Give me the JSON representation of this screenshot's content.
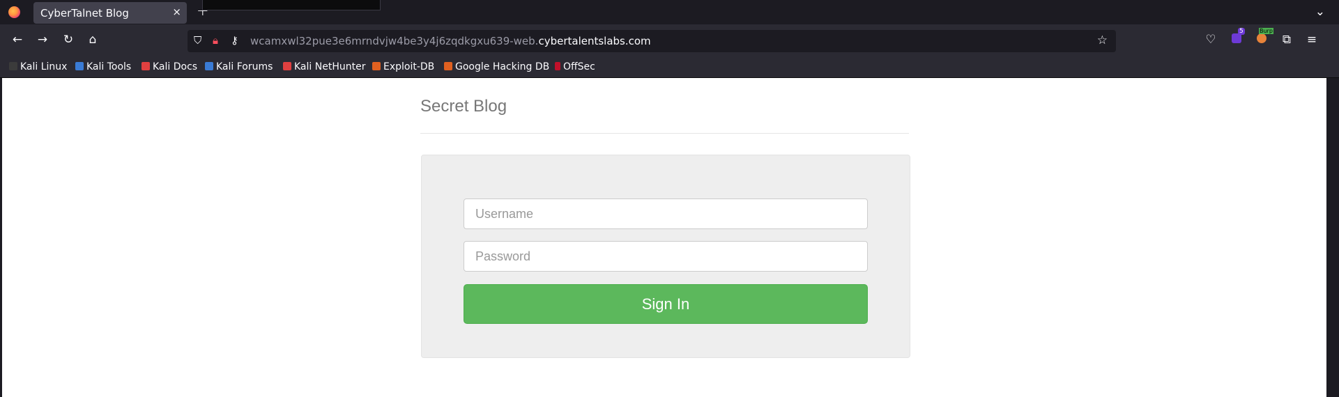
{
  "browser": {
    "tab_title": "CyberTalnet Blog",
    "tab_close": "×",
    "new_tab": "+",
    "tab_list": "⌄",
    "url_prefix": "wcamxwl32pue3e6mrndvjw4be3y4j6zqdkgxu639-web.",
    "url_domain": "cybertalentslabs.com",
    "extension_badge": "5",
    "burp_badge": "Burp",
    "icons": [
      "back-icon",
      "forward-icon",
      "reload-icon",
      "home-icon",
      "shield-icon",
      "lock-icon",
      "key-icon",
      "star-icon",
      "pocket-icon",
      "extensions-icon",
      "menu-icon"
    ]
  },
  "bookmarks": [
    {
      "label": "Kali Linux",
      "color": "#3b3b3b"
    },
    {
      "label": "Kali Tools",
      "color": "#3a7bd5"
    },
    {
      "label": "Kali Docs",
      "color": "#e04040"
    },
    {
      "label": "Kali Forums",
      "color": "#3a7bd5"
    },
    {
      "label": "Kali NetHunter",
      "color": "#e04040"
    },
    {
      "label": "Exploit-DB",
      "color": "#e06020"
    },
    {
      "label": "Google Hacking DB",
      "color": "#e06020"
    },
    {
      "label": "OffSec",
      "color": "#c0102a"
    }
  ],
  "page": {
    "title": "Secret Blog",
    "username_placeholder": "Username",
    "password_placeholder": "Password",
    "signin_label": "Sign In",
    "accent": "#5cb85c"
  }
}
